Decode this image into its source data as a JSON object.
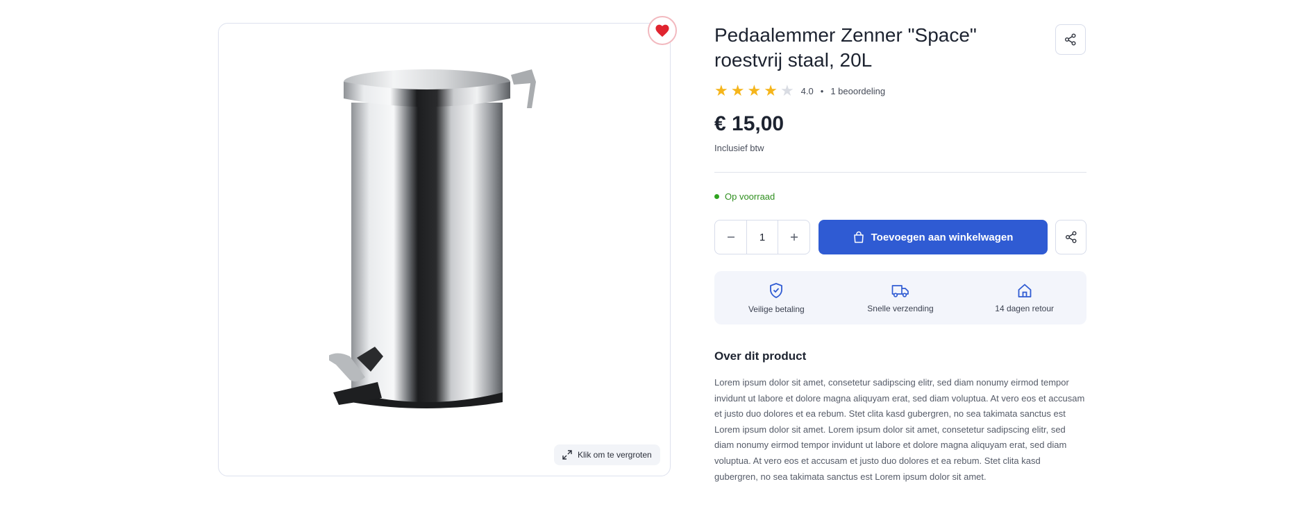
{
  "product": {
    "title": "Pedaalemmer Zenner \"Space\" roestvrij staal, 20L",
    "rating_value": "4.0",
    "rating_stars": 4,
    "rating_max": 5,
    "rating_separator": "•",
    "review_count_label": "1 beoordeling",
    "price": "€ 15,00",
    "vat_label": "Inclusief btw",
    "stock_status": "Op voorraad"
  },
  "gallery": {
    "zoom_label": "Klik om te vergroten"
  },
  "purchase": {
    "quantity": "1",
    "add_to_cart_label": "Toevoegen aan winkelwagen"
  },
  "usps": [
    {
      "icon": "shield-check-icon",
      "label": "Veilige betaling"
    },
    {
      "icon": "truck-icon",
      "label": "Snelle verzending"
    },
    {
      "icon": "home-icon",
      "label": "14 dagen retour"
    }
  ],
  "about": {
    "heading": "Over dit product",
    "description": "Lorem ipsum dolor sit amet, consetetur sadipscing elitr, sed diam nonumy eirmod tempor invidunt ut labore et dolore magna aliquyam erat, sed diam voluptua. At vero eos et accusam et justo duo dolores et ea rebum. Stet clita kasd gubergren, no sea takimata sanctus est Lorem ipsum dolor sit amet. Lorem ipsum dolor sit amet, consetetur sadipscing elitr, sed diam nonumy eirmod tempor invidunt ut labore et dolore magna aliquyam erat, sed diam voluptua. At vero eos et accusam et justo duo dolores et ea rebum. Stet clita kasd gubergren, no sea takimata sanctus est Lorem ipsum dolor sit amet."
  },
  "colors": {
    "accent": "#2f5bd3",
    "star_filled": "#f5b51b",
    "star_empty": "#d9dce3",
    "in_stock": "#2fa31f",
    "favorite": "#e0242f"
  }
}
